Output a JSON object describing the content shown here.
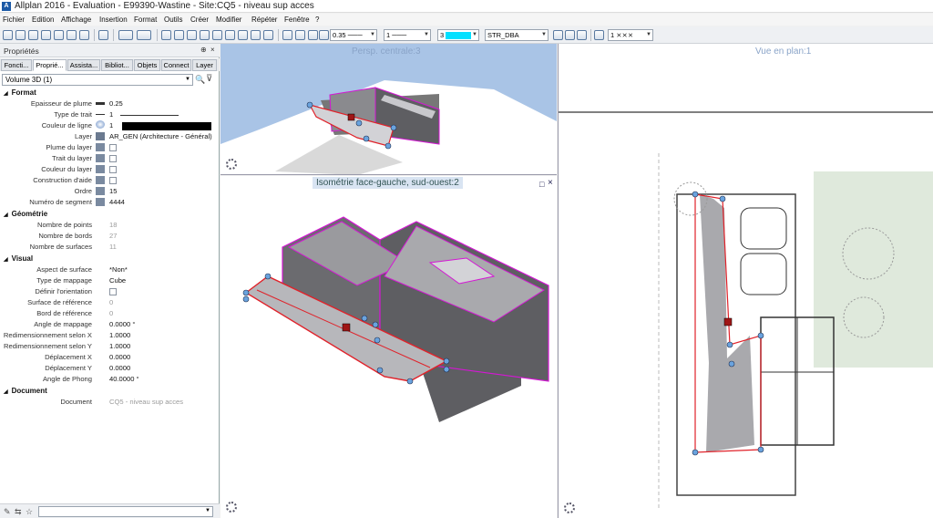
{
  "window": {
    "title": "Allplan 2016 - Evaluation - E99390-Wastine - Site:CQ5 - niveau sup acces",
    "logo_letter": "A"
  },
  "menu": [
    "Fichier",
    "Edition",
    "Affichage",
    "Insertion",
    "Format",
    "Outils",
    "Créer",
    "Modifier",
    "Répéter",
    "Fenêtre",
    "?"
  ],
  "toolbar": {
    "pen_thickness": "0.35",
    "line_type": "1",
    "color_index": "3",
    "layer": "STR_DBA",
    "scale": "1",
    "accent_color": "#00e0ff"
  },
  "panel": {
    "title": "Propriétés",
    "pin": "⊕",
    "close": "×",
    "tabs": [
      "Foncti...",
      "Proprié...",
      "Assista...",
      "Bibliot...",
      "Objets",
      "Connect",
      "Layer"
    ],
    "active_tab": 1,
    "selected_object": "Volume 3D (1)",
    "sections": {
      "format": "Format",
      "geometry": "Géométrie",
      "visual": "Visual",
      "document": "Document"
    },
    "format_rows": [
      {
        "label": "Epaisseur de plume",
        "value": "0.25"
      },
      {
        "label": "Type de trait",
        "value": "1"
      },
      {
        "label": "Couleur de ligne",
        "value": "1"
      },
      {
        "label": "Layer",
        "value": "AR_GEN (Architecture - Général)"
      },
      {
        "label": "Plume du layer",
        "value": ""
      },
      {
        "label": "Trait du layer",
        "value": ""
      },
      {
        "label": "Couleur du layer",
        "value": ""
      },
      {
        "label": "Construction d'aide",
        "value": ""
      },
      {
        "label": "Ordre",
        "value": "15"
      },
      {
        "label": "Numéro de segment",
        "value": "4444"
      }
    ],
    "geometry_rows": [
      {
        "label": "Nombre de points",
        "value": "18"
      },
      {
        "label": "Nombre de bords",
        "value": "27"
      },
      {
        "label": "Nombre de surfaces",
        "value": "11"
      }
    ],
    "visual_rows": [
      {
        "label": "Aspect de surface",
        "value": "*Non*"
      },
      {
        "label": "Type de mappage",
        "value": "Cube"
      },
      {
        "label": "Définir l'orientation",
        "value": ""
      },
      {
        "label": "Surface de référence",
        "value": "0"
      },
      {
        "label": "Bord de référence",
        "value": "0"
      },
      {
        "label": "Angle de mappage",
        "value": "0.0000 °"
      },
      {
        "label": "Redimensionnement selon X",
        "value": "1.0000"
      },
      {
        "label": "Redimensionnement selon Y",
        "value": "1.0000"
      },
      {
        "label": "Déplacement X",
        "value": "0.0000"
      },
      {
        "label": "Déplacement Y",
        "value": "0.0000"
      },
      {
        "label": "Angle de Phong",
        "value": "40.0000 °"
      }
    ],
    "document_rows": [
      {
        "label": "Document",
        "value": "CQ5 - niveau sup acces"
      }
    ]
  },
  "viewports": {
    "persp": {
      "label": "Persp. centrale:3"
    },
    "iso": {
      "label": "Isométrie face-gauche, sud-ouest:2"
    },
    "plan": {
      "label": "Vue en plan:1"
    }
  },
  "colors": {
    "highlight": "#d417d4",
    "selection": "#e0222a",
    "handle": "#6aa3de",
    "wall": "#5e5e62",
    "floor": "#a9a9ad",
    "sky": "#a9c4e6"
  }
}
